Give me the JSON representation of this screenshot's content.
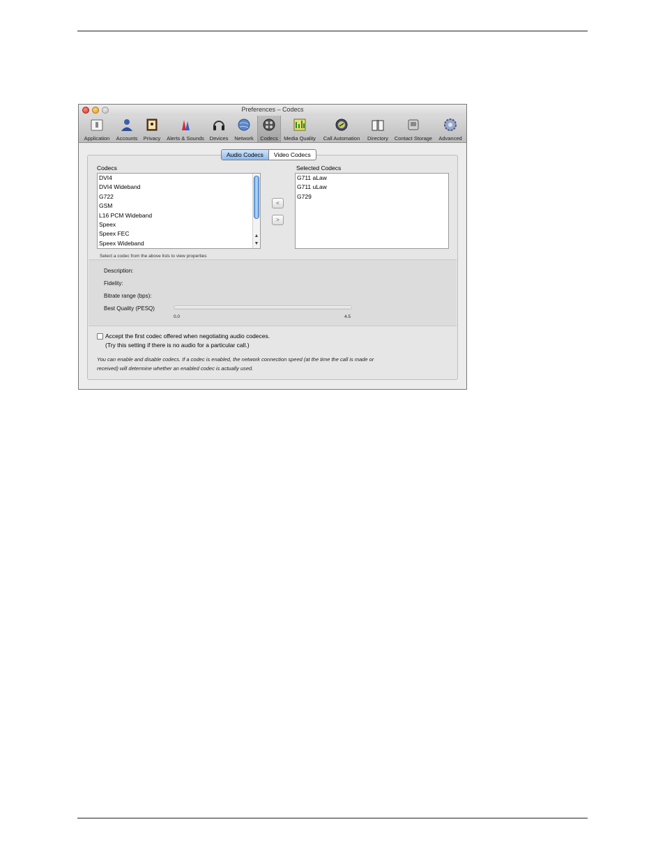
{
  "window": {
    "title": "Preferences – Codecs"
  },
  "toolbar": {
    "items": [
      {
        "label": "Application",
        "icon": "application-icon"
      },
      {
        "label": "Accounts",
        "icon": "accounts-icon"
      },
      {
        "label": "Privacy",
        "icon": "privacy-icon"
      },
      {
        "label": "Alerts & Sounds",
        "icon": "alerts-sounds-icon"
      },
      {
        "label": "Devices",
        "icon": "headset-icon"
      },
      {
        "label": "Network",
        "icon": "network-globe-icon"
      },
      {
        "label": "Codecs",
        "icon": "codecs-film-icon",
        "selected": true
      },
      {
        "label": "Media Quality",
        "icon": "media-quality-icon"
      },
      {
        "label": "Call Automation",
        "icon": "call-automation-icon"
      },
      {
        "label": "Directory",
        "icon": "directory-book-icon"
      },
      {
        "label": "Contact Storage",
        "icon": "contact-storage-icon"
      },
      {
        "label": "Advanced",
        "icon": "gear-icon"
      }
    ]
  },
  "tabs": {
    "audio": "Audio Codecs",
    "video": "Video Codecs",
    "selected": "audio"
  },
  "codecs": {
    "label": "Codecs",
    "items": [
      "DVI4",
      "DVI4 Wideband",
      "G722",
      "GSM",
      "L16 PCM Wideband",
      "Speex",
      "Speex FEC",
      "Speex Wideband"
    ]
  },
  "selected_codecs": {
    "label": "Selected Codecs",
    "items": [
      "G711 aLaw",
      "G711 uLaw",
      "G729"
    ]
  },
  "move_buttons": {
    "left": "<",
    "right": ">"
  },
  "properties": {
    "hint": "Select a codec from the above lists to view properties",
    "description_label": "Description:",
    "fidelity_label": "Fidelity:",
    "bitrate_label": "Bitrate range (bps):",
    "quality_label": "Best Quality (PESQ)",
    "quality_min": "0.0",
    "quality_max": "4.5"
  },
  "option": {
    "label": "Accept the first codec offered when negotiating audio codeces.",
    "sublabel": "(Try this setting if there is no audio for a particular call.)",
    "checked": false
  },
  "footer_note": {
    "line1": "You can enable and disable codecs. If a codec is enabled, the network connection speed (at the time the call is made or",
    "line2": "received) will determine whether an enabled codec is actually used."
  }
}
